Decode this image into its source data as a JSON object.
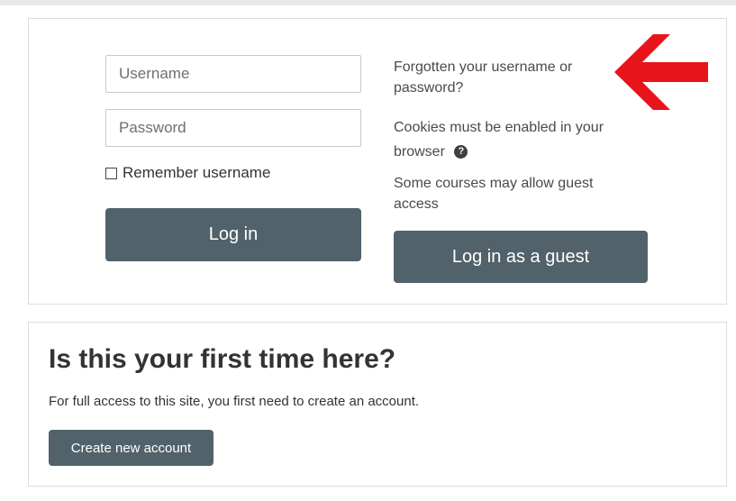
{
  "login": {
    "username_placeholder": "Username",
    "password_placeholder": "Password",
    "remember_label": "Remember username",
    "login_button": "Log in",
    "forgot_link": "Forgotten your username or password?",
    "cookies_text": "Cookies must be enabled in your browser",
    "guest_note": "Some courses may allow guest access",
    "guest_button": "Log in as a guest"
  },
  "signup": {
    "title": "Is this your first time here?",
    "description": "For full access to this site, you first need to create an account.",
    "create_button": "Create new account"
  },
  "colors": {
    "button": "#51626a",
    "arrow": "#e8141b"
  },
  "icons": {
    "help": "help-icon",
    "pointer": "red-arrow-icon"
  }
}
